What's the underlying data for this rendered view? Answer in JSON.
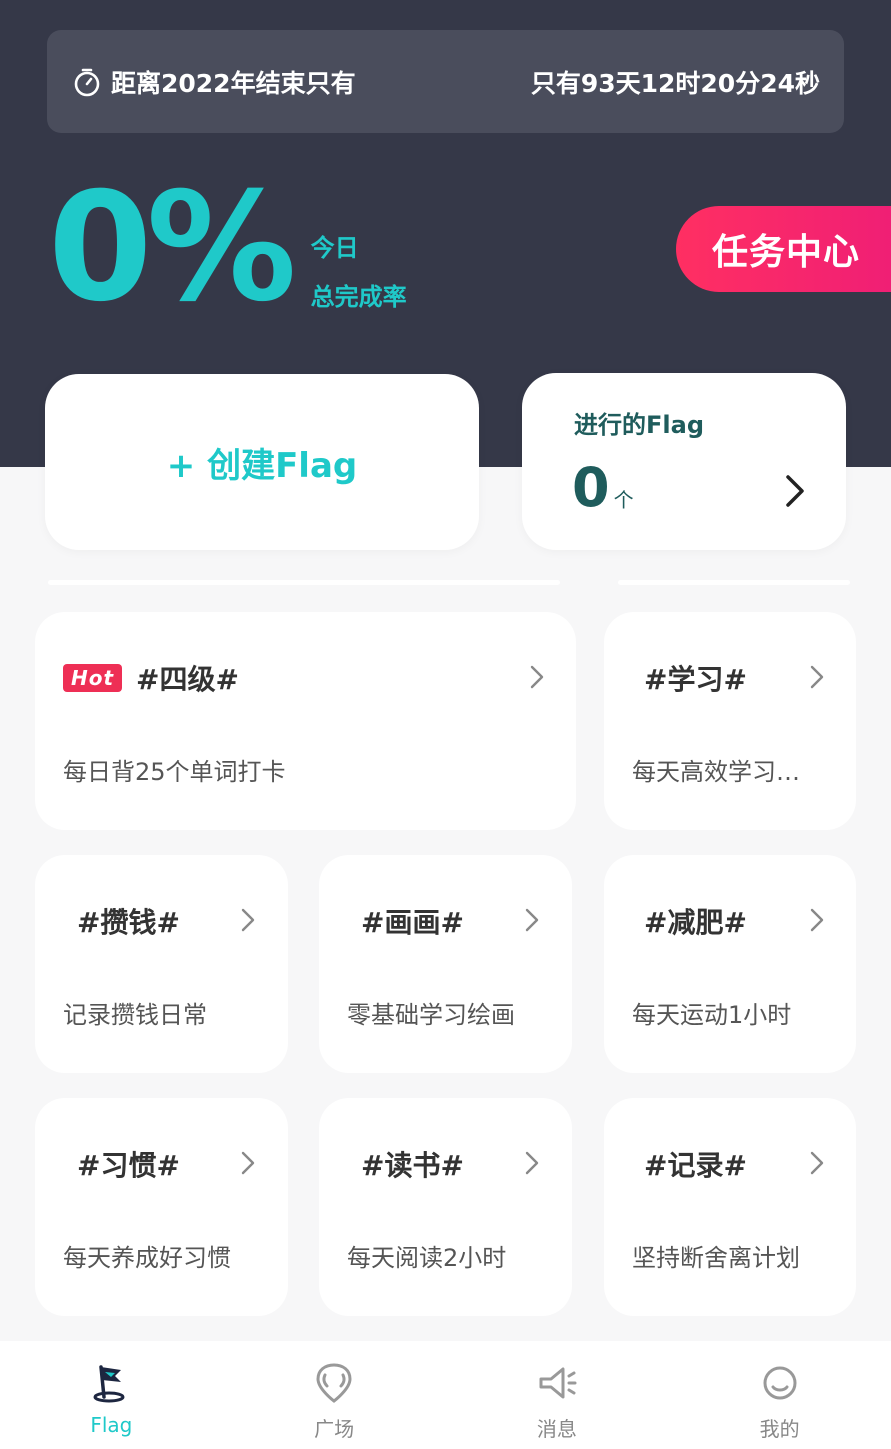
{
  "countdown": {
    "label": "距离2022年结束只有",
    "value": "只有93天12时20分24秒"
  },
  "completion": {
    "percent": "0%",
    "label_line1": "今日",
    "label_line2": "总完成率"
  },
  "task_center": {
    "label": "任务中心"
  },
  "create_flag": {
    "label": "+ 创建Flag"
  },
  "ongoing_flag": {
    "title": "进行的Flag",
    "count": "0",
    "unit": "个"
  },
  "topics": [
    {
      "hot_badge": "Hot",
      "title": "#四级#",
      "subtitle": "每日背25个单词打卡"
    },
    {
      "title": "#学习#",
      "subtitle": "每天高效学习…"
    },
    {
      "title": "#攒钱#",
      "subtitle": "记录攒钱日常"
    },
    {
      "title": "#画画#",
      "subtitle": "零基础学习绘画"
    },
    {
      "title": "#减肥#",
      "subtitle": "每天运动1小时"
    },
    {
      "title": "#习惯#",
      "subtitle": "每天养成好习惯"
    },
    {
      "title": "#读书#",
      "subtitle": "每天阅读2小时"
    },
    {
      "title": "#记录#",
      "subtitle": "坚持断舍离计划"
    }
  ],
  "tabbar": {
    "items": [
      {
        "label": "Flag",
        "icon": "flag-icon"
      },
      {
        "label": "广场",
        "icon": "plaza-icon"
      },
      {
        "label": "消息",
        "icon": "megaphone-icon"
      },
      {
        "label": "我的",
        "icon": "profile-icon"
      }
    ]
  },
  "colors": {
    "header_bg": "#353848",
    "accent": "#1fc9c9",
    "task_center": "#ff2f62",
    "hot_badge": "#ee2f55"
  }
}
